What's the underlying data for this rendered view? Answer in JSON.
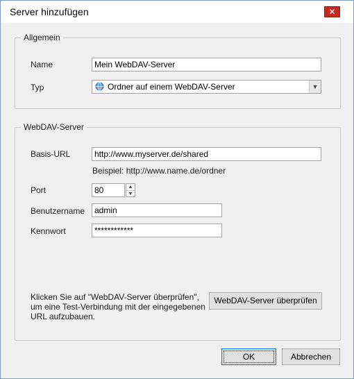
{
  "window": {
    "title": "Server hinzufügen",
    "close_glyph": "✕"
  },
  "general": {
    "legend": "Allgemein",
    "name_label": "Name",
    "name_value": "Mein WebDAV-Server",
    "type_label": "Typ",
    "type_value": "Ordner auf einem WebDAV-Server",
    "type_icon": "globe-icon"
  },
  "webdav": {
    "legend": "WebDAV-Server",
    "url_label": "Basis-URL",
    "url_value": "http://www.myserver.de/shared",
    "url_example": "Beispiel: http://www.name.de/ordner",
    "port_label": "Port",
    "port_value": "80",
    "user_label": "Benutzername",
    "user_value": "admin",
    "password_label": "Kennwort",
    "password_value": "************",
    "hint_line1": "Klicken Sie auf \"WebDAV-Server überprüfen\",",
    "hint_line2": "um eine Test-Verbindung mit der eingegebenen",
    "hint_line3": "URL aufzubauen.",
    "check_button": "WebDAV-Server überprüfen"
  },
  "footer": {
    "ok_label": "OK",
    "cancel_label": "Abbrechen"
  },
  "colors": {
    "accent": "#0078d7",
    "close": "#c42b1c"
  }
}
